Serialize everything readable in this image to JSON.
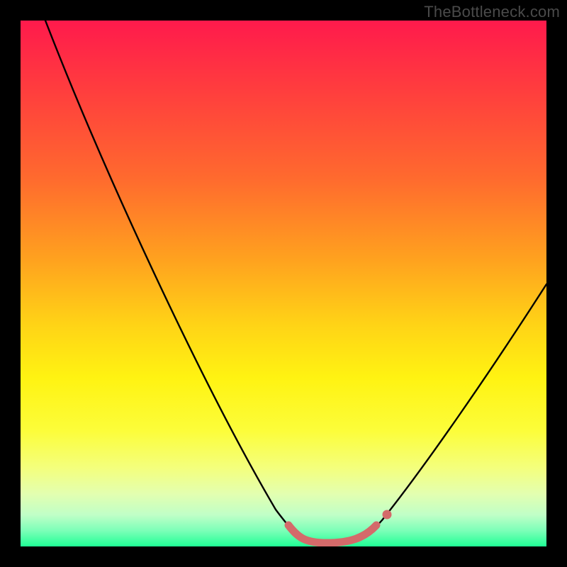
{
  "watermark": {
    "text": "TheBottleneck.com"
  },
  "chart_data": {
    "type": "line",
    "title": "",
    "xlabel": "",
    "ylabel": "",
    "xlim": [
      0,
      100
    ],
    "ylim": [
      0,
      100
    ],
    "grid": false,
    "legend": false,
    "series": [
      {
        "name": "bottleneck-curve",
        "x": [
          5,
          10,
          15,
          20,
          25,
          30,
          35,
          40,
          45,
          50,
          52,
          55,
          58,
          62,
          65,
          68,
          72,
          78,
          85,
          92,
          100
        ],
        "y": [
          100,
          88,
          76,
          64,
          53,
          42,
          32,
          23,
          15,
          8,
          5,
          3,
          2,
          2,
          3,
          4,
          7,
          14,
          24,
          36,
          50
        ]
      }
    ],
    "markers": [
      {
        "name": "flat-region-pink",
        "x_range": [
          52,
          68
        ],
        "y": 2.5
      },
      {
        "name": "marker-dot-pink",
        "x": 68,
        "y": 4
      }
    ],
    "colors": {
      "curve": "#000000",
      "marker": "#d46a6a",
      "gradient_top": "#ff1a4c",
      "gradient_bottom": "#1fff95"
    }
  }
}
